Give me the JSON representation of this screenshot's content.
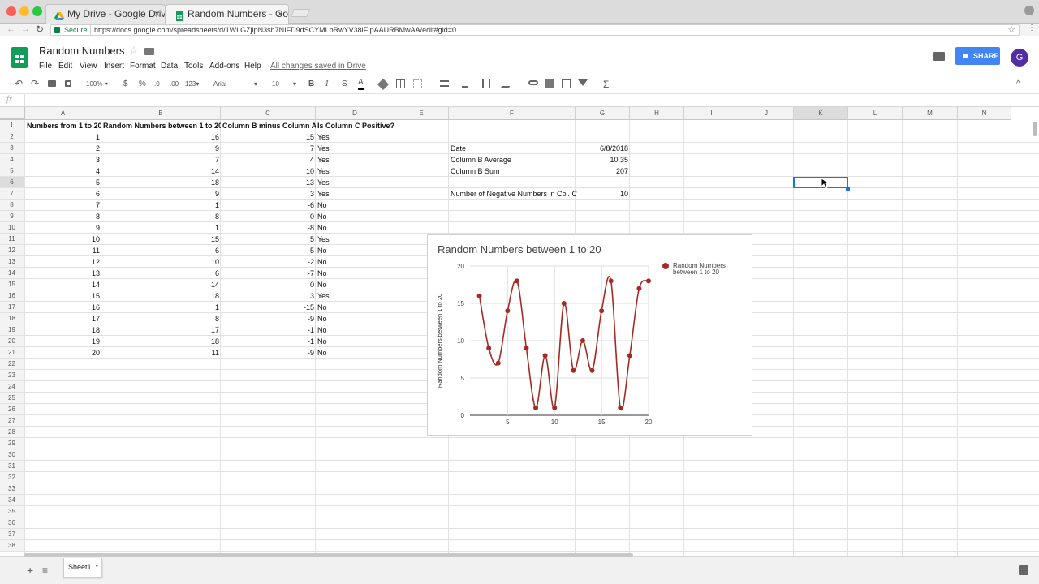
{
  "browser": {
    "tabs": [
      {
        "title": "My Drive - Google Drive",
        "close": "×"
      },
      {
        "title": "Random Numbers - Google Sh",
        "close": "×"
      }
    ],
    "secure_label": "Secure",
    "url": "https://docs.google.com/spreadsheets/d/1WLGZjlpN3sh7NIFD9dSCYMLbRwYV38iFIpAAURBMwAA/edit#gid=0"
  },
  "doc": {
    "title": "Random Numbers",
    "menus": [
      "File",
      "Edit",
      "View",
      "Insert",
      "Format",
      "Data",
      "Tools",
      "Add-ons",
      "Help"
    ],
    "saved_status": "All changes saved in Drive",
    "share_label": "SHARE",
    "avatar_letter": "G"
  },
  "toolbar": {
    "zoom": "100%",
    "currency": "$",
    "percent": "%",
    "dec_less": ".0",
    "dec_more": ".00",
    "format_more": "123",
    "font": "Arial",
    "size": "10",
    "bold": "B",
    "italic": "I",
    "strike": "S",
    "textcolor": "A",
    "sum": "Σ"
  },
  "formula_bar": {
    "fx": "fx",
    "value": ""
  },
  "columns": [
    "A",
    "B",
    "C",
    "D",
    "E",
    "F",
    "G",
    "H",
    "I",
    "J",
    "K",
    "L",
    "M",
    "N"
  ],
  "row_numbers": [
    "1",
    "2",
    "3",
    "4",
    "5",
    "6",
    "7",
    "8",
    "9",
    "10",
    "11",
    "12",
    "13",
    "14",
    "15",
    "16",
    "17",
    "18",
    "19",
    "20",
    "21",
    "22",
    "23",
    "24",
    "25",
    "26",
    "27",
    "28",
    "29",
    "30",
    "31",
    "32",
    "33",
    "34",
    "35",
    "36",
    "37",
    "38"
  ],
  "headers": [
    "Numbers from 1 to 20",
    "Random Numbers between 1 to 20",
    "Column B minus Column A",
    "Is Column C Positive?"
  ],
  "table_rows": [
    [
      "1",
      "16",
      "15",
      "Yes"
    ],
    [
      "2",
      "9",
      "7",
      "Yes"
    ],
    [
      "3",
      "7",
      "4",
      "Yes"
    ],
    [
      "4",
      "14",
      "10",
      "Yes"
    ],
    [
      "5",
      "18",
      "13",
      "Yes"
    ],
    [
      "6",
      "9",
      "3",
      "Yes"
    ],
    [
      "7",
      "1",
      "-6",
      "No"
    ],
    [
      "8",
      "8",
      "0",
      "No"
    ],
    [
      "9",
      "1",
      "-8",
      "No"
    ],
    [
      "10",
      "15",
      "5",
      "Yes"
    ],
    [
      "11",
      "6",
      "-5",
      "No"
    ],
    [
      "12",
      "10",
      "-2",
      "No"
    ],
    [
      "13",
      "6",
      "-7",
      "No"
    ],
    [
      "14",
      "14",
      "0",
      "No"
    ],
    [
      "15",
      "18",
      "3",
      "Yes"
    ],
    [
      "16",
      "1",
      "-15",
      "No"
    ],
    [
      "17",
      "8",
      "-9",
      "No"
    ],
    [
      "18",
      "17",
      "-1",
      "No"
    ],
    [
      "19",
      "18",
      "-1",
      "No"
    ],
    [
      "20",
      "11",
      "-9",
      "No"
    ]
  ],
  "summary": [
    {
      "label": "Date",
      "value": "6/8/2018"
    },
    {
      "label": "Column B Average",
      "value": "10.35"
    },
    {
      "label": "Column B Sum",
      "value": "207"
    },
    {
      "label": "Number of Negative Numbers in Col. C",
      "value": "10"
    }
  ],
  "chart_data": {
    "type": "line",
    "title": "Random Numbers between 1 to 20",
    "ylabel": "Random Numbers between 1 to 20",
    "xlabel": "",
    "x": [
      2,
      3,
      4,
      5,
      6,
      7,
      8,
      9,
      10,
      11,
      12,
      13,
      14,
      15,
      16,
      17,
      18,
      19,
      20
    ],
    "series": [
      {
        "name": "Random Numbers between 1 to 20",
        "values": [
          16,
          9,
          7,
          14,
          18,
          9,
          1,
          8,
          1,
          15,
          6,
          10,
          6,
          14,
          18,
          1,
          8,
          17,
          18
        ],
        "color": "#a52a24"
      }
    ],
    "xlim": [
      1,
      20
    ],
    "ylim": [
      0,
      20
    ],
    "xticks": [
      "5",
      "10",
      "15",
      "20"
    ],
    "yticks": [
      "0",
      "5",
      "10",
      "15",
      "20"
    ],
    "legend_position": "right",
    "grid": true
  },
  "sheet_tab": "Sheet1",
  "colors": {
    "accent": "#4285f4",
    "sheets_green": "#0f9d58",
    "series": "#a52a24",
    "selection": "#1a73e8"
  }
}
